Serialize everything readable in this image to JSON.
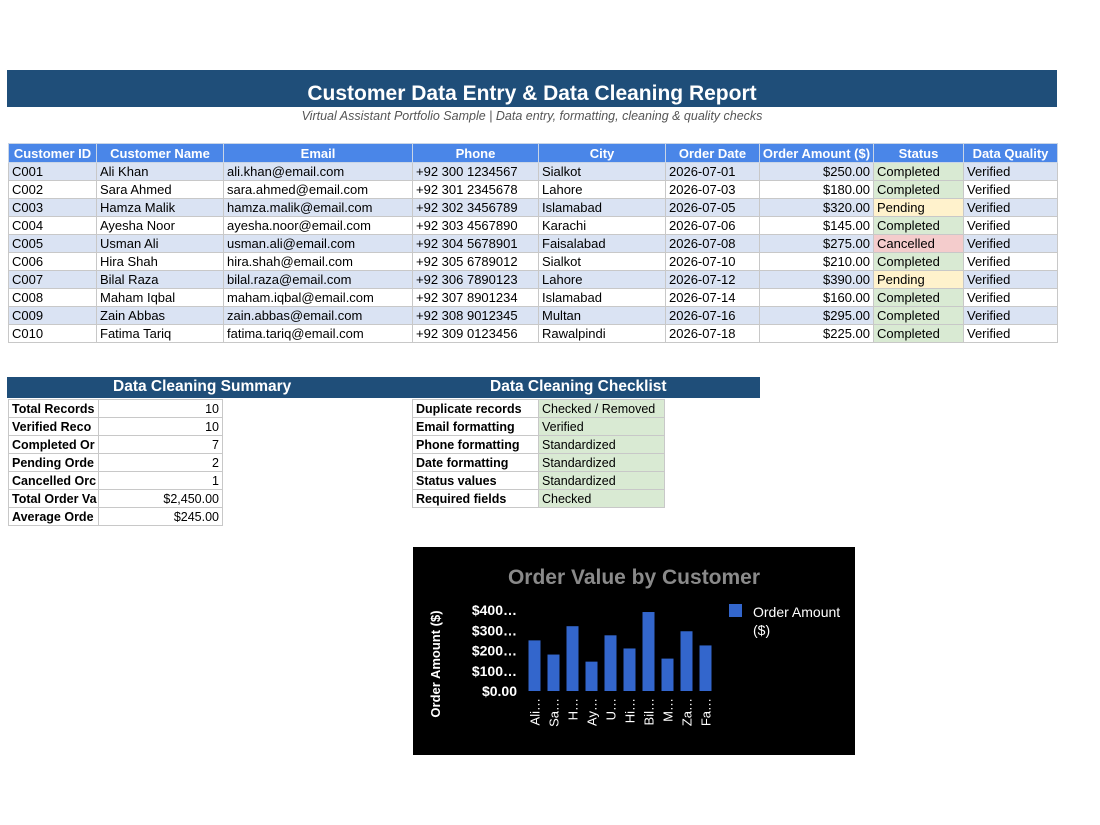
{
  "report": {
    "title": "Customer Data Entry & Data Cleaning Report",
    "subtitle": "Virtual Assistant Portfolio Sample | Data entry, formatting, cleaning & quality checks"
  },
  "colors": {
    "header_band": "#1f4e79",
    "table_header": "#4a86e8",
    "row_stripe": "#dae3f3",
    "status_completed": "#d9ead3",
    "status_pending": "#fff2cc",
    "status_cancelled": "#f4cccc",
    "bar": "#3366cc"
  },
  "table": {
    "headers": [
      "Customer ID",
      "Customer Name",
      "Email",
      "Phone",
      "City",
      "Order Date",
      "Order Amount ($)",
      "Status",
      "Data Quality"
    ],
    "rows": [
      [
        "C001",
        "Ali Khan",
        "ali.khan@email.com",
        "+92 300 1234567",
        "Sialkot",
        "2026-07-01",
        "$250.00",
        "Completed",
        "Verified"
      ],
      [
        "C002",
        "Sara Ahmed",
        "sara.ahmed@email.com",
        "+92 301 2345678",
        "Lahore",
        "2026-07-03",
        "$180.00",
        "Completed",
        "Verified"
      ],
      [
        "C003",
        "Hamza Malik",
        "hamza.malik@email.com",
        "+92 302 3456789",
        "Islamabad",
        "2026-07-05",
        "$320.00",
        "Pending",
        "Verified"
      ],
      [
        "C004",
        "Ayesha Noor",
        "ayesha.noor@email.com",
        "+92 303 4567890",
        "Karachi",
        "2026-07-06",
        "$145.00",
        "Completed",
        "Verified"
      ],
      [
        "C005",
        "Usman Ali",
        "usman.ali@email.com",
        "+92 304 5678901",
        "Faisalabad",
        "2026-07-08",
        "$275.00",
        "Cancelled",
        "Verified"
      ],
      [
        "C006",
        "Hira Shah",
        "hira.shah@email.com",
        "+92 305 6789012",
        "Sialkot",
        "2026-07-10",
        "$210.00",
        "Completed",
        "Verified"
      ],
      [
        "C007",
        "Bilal Raza",
        "bilal.raza@email.com",
        "+92 306 7890123",
        "Lahore",
        "2026-07-12",
        "$390.00",
        "Pending",
        "Verified"
      ],
      [
        "C008",
        "Maham Iqbal",
        "maham.iqbal@email.com",
        "+92 307 8901234",
        "Islamabad",
        "2026-07-14",
        "$160.00",
        "Completed",
        "Verified"
      ],
      [
        "C009",
        "Zain Abbas",
        "zain.abbas@email.com",
        "+92 308 9012345",
        "Multan",
        "2026-07-16",
        "$295.00",
        "Completed",
        "Verified"
      ],
      [
        "C010",
        "Fatima Tariq",
        "fatima.tariq@email.com",
        "+92 309 0123456",
        "Rawalpindi",
        "2026-07-18",
        "$225.00",
        "Completed",
        "Verified"
      ]
    ]
  },
  "summary": {
    "title": "Data Cleaning Summary",
    "rows": [
      {
        "label": "Total Records",
        "value": "10"
      },
      {
        "label": "Verified Reco",
        "value": "10"
      },
      {
        "label": "Completed Or",
        "value": "7"
      },
      {
        "label": "Pending Orde",
        "value": "2"
      },
      {
        "label": "Cancelled Orc",
        "value": "1"
      },
      {
        "label": "Total Order Va",
        "value": "$2,450.00"
      },
      {
        "label": "Average Orde",
        "value": "$245.00"
      }
    ]
  },
  "checklist": {
    "title": "Data Cleaning Checklist",
    "rows": [
      {
        "label": "Duplicate records",
        "value": "Checked / Removed"
      },
      {
        "label": "Email formatting",
        "value": "Verified"
      },
      {
        "label": "Phone formatting",
        "value": "Standardized"
      },
      {
        "label": "Date formatting",
        "value": "Standardized"
      },
      {
        "label": "Status values",
        "value": "Standardized"
      },
      {
        "label": "Required fields",
        "value": "Checked"
      }
    ]
  },
  "chart_data": {
    "type": "bar",
    "title": "Order Value by Customer",
    "ylabel": "Order Amount ($)",
    "xlabel": "",
    "categories": [
      "Ali…",
      "Sa…",
      "H…",
      "Ay…",
      "U…",
      "Hi…",
      "Bil…",
      "M…",
      "Za…",
      "Fa…"
    ],
    "series": [
      {
        "name": "Order Amount ($)",
        "values": [
          250,
          180,
          320,
          145,
          275,
          210,
          390,
          160,
          295,
          225
        ]
      }
    ],
    "yticks": [
      "$0.00",
      "$100.00",
      "$200.00",
      "$300.00",
      "$400.00"
    ],
    "ytick_labels": [
      "$0.00",
      "$100…",
      "$200…",
      "$300…",
      "$400…"
    ],
    "ylim": [
      0,
      400
    ],
    "legend": "right",
    "grid": false
  }
}
